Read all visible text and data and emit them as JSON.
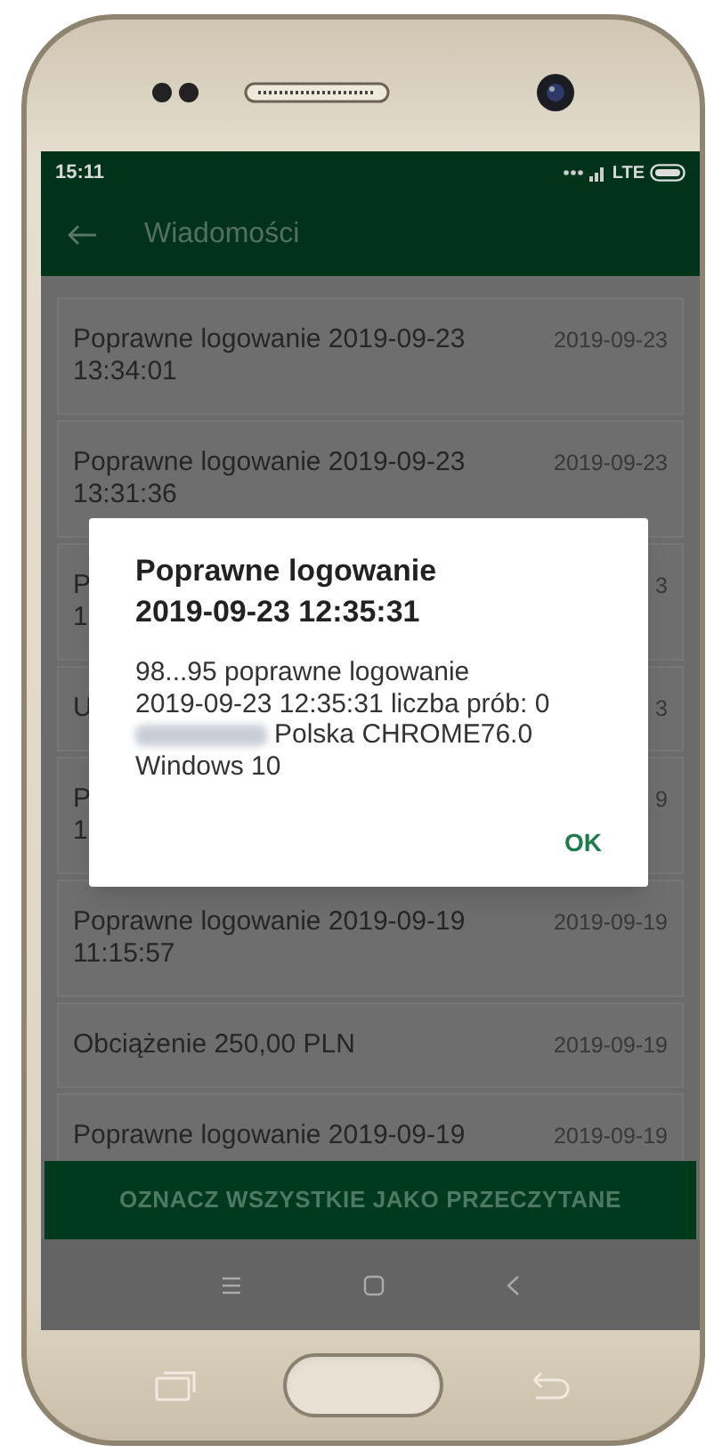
{
  "status_bar": {
    "time": "15:11",
    "network": "LTE"
  },
  "header": {
    "title": "Wiadomości"
  },
  "messages": [
    {
      "lines": [
        "Poprawne logowanie 2019-09-23",
        "13:34:01"
      ],
      "date": "2019-09-23"
    },
    {
      "lines": [
        "Poprawne logowanie 2019-09-23",
        "13:31:36"
      ],
      "date": "2019-09-23"
    },
    {
      "lines": [
        "P",
        "1"
      ],
      "date": "3"
    },
    {
      "lines": [
        "U"
      ],
      "date": "3"
    },
    {
      "lines": [
        "P",
        "1"
      ],
      "date": "9"
    },
    {
      "lines": [
        "Poprawne logowanie 2019-09-19",
        "11:15:57"
      ],
      "date": "2019-09-19"
    },
    {
      "lines": [
        "Obciążenie 250,00 PLN"
      ],
      "date": "2019-09-19"
    },
    {
      "lines": [
        "Poprawne logowanie 2019-09-19"
      ],
      "date": "2019-09-19"
    }
  ],
  "mark_all_button": "OZNACZ WSZYSTKIE JAKO PRZECZYTANE",
  "dialog": {
    "title": "Poprawne logowanie 2019-09-23 12:35:31",
    "lines": [
      {
        "text": "98...95 poprawne logowanie",
        "redacted_prefix": false
      },
      {
        "text": "2019-09-23 12:35:31 liczba prób: 0",
        "redacted_prefix": false
      },
      {
        "text": "Polska CHROME76.0",
        "redacted_prefix": true
      },
      {
        "text": "Windows 10",
        "redacted_prefix": false
      }
    ],
    "ok": "OK"
  }
}
